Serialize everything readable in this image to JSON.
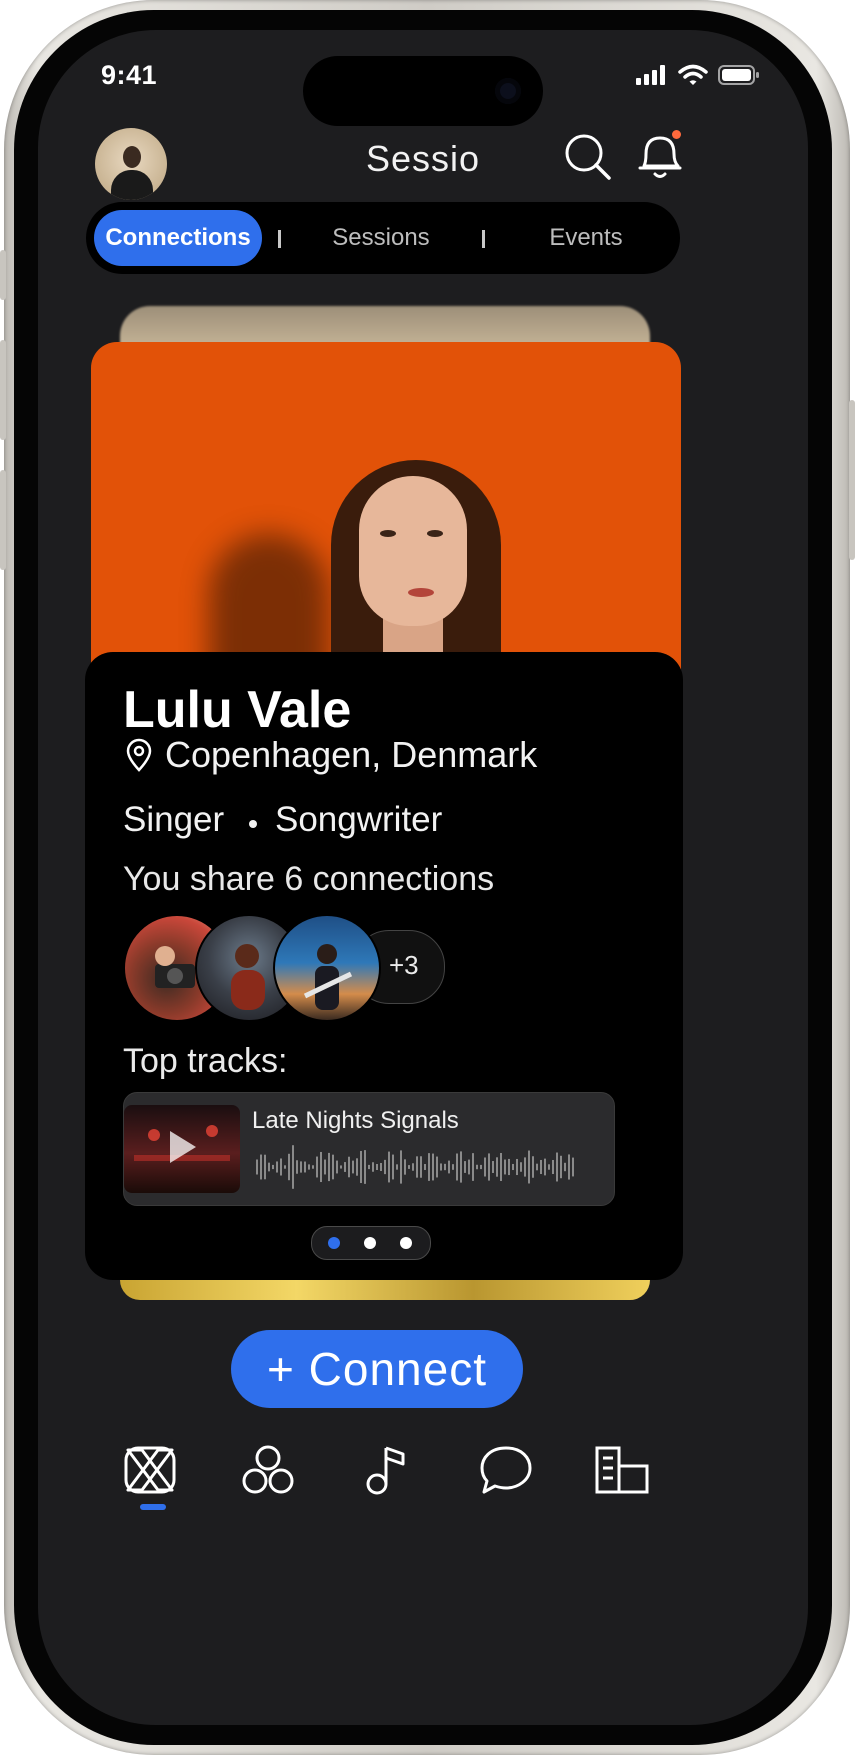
{
  "status": {
    "time": "9:41"
  },
  "header": {
    "title": "Sessio"
  },
  "tabs": [
    {
      "label": "Connections",
      "active": true
    },
    {
      "label": "Sessions",
      "active": false
    },
    {
      "label": "Events",
      "active": false
    }
  ],
  "profile": {
    "name": "Lulu Vale",
    "location": "Copenhagen, Denmark",
    "roles": [
      "Singer",
      "Songwriter"
    ],
    "shared_text": "You share 6 connections",
    "more_count": "+3",
    "top_tracks_label": "Top tracks:",
    "track": {
      "title": "Late Nights Signals"
    },
    "pager": {
      "total": 3,
      "active_index": 0
    }
  },
  "actions": {
    "connect_label": "+ Connect"
  },
  "bottom_nav": [
    {
      "icon": "connections-icon",
      "active": true
    },
    {
      "icon": "groups-icon",
      "active": false
    },
    {
      "icon": "music-note-icon",
      "active": false
    },
    {
      "icon": "chat-bubble-icon",
      "active": false
    },
    {
      "icon": "venues-icon",
      "active": false
    }
  ],
  "colors": {
    "accent": "#2f6fec",
    "photo_bg": "#e25208",
    "notification": "#ff6a3d"
  }
}
